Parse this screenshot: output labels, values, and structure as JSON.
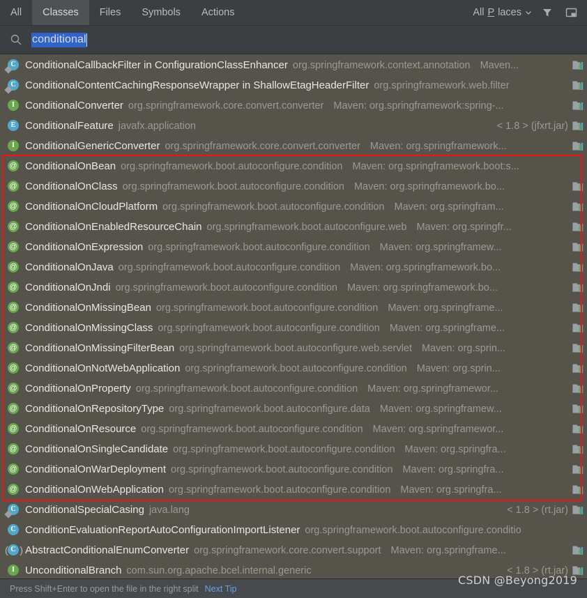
{
  "header": {
    "tabs": [
      {
        "label": "All",
        "active": false
      },
      {
        "label": "Classes",
        "active": true
      },
      {
        "label": "Files",
        "active": false
      },
      {
        "label": "Symbols",
        "active": false
      },
      {
        "label": "Actions",
        "active": false
      }
    ],
    "places_label_pre": "All ",
    "places_label_underlined": "P",
    "places_label_post": "laces",
    "filter_icon": "filter-funnel-icon",
    "preview_icon": "preview-panel-icon",
    "chevron_icon": "chevron-down-icon"
  },
  "search": {
    "icon": "search-icon",
    "value": "conditional",
    "selected": true
  },
  "results": [
    {
      "icon": "class-icon",
      "kind": "cls",
      "sub": true,
      "name": "ConditionalCallbackFilter in ConfigurationClassEnhancer",
      "pkg": "org.springframework.context.annotation",
      "loc": "Maven...",
      "loc_align": "left",
      "lib": true
    },
    {
      "icon": "class-icon",
      "kind": "cls",
      "sub": true,
      "name": "ConditionalContentCachingResponseWrapper in ShallowEtagHeaderFilter",
      "pkg": "org.springframework.web.filter",
      "loc": "",
      "loc_align": "left",
      "lib": true
    },
    {
      "icon": "interface-icon",
      "kind": "iface",
      "sub": false,
      "name": "ConditionalConverter",
      "pkg": "org.springframework.core.convert.converter",
      "loc": "Maven: org.springframework:spring-...",
      "loc_align": "left",
      "lib": true
    },
    {
      "icon": "enum-icon",
      "kind": "enum",
      "sub": false,
      "name": "ConditionalFeature",
      "pkg": "javafx.application",
      "loc": "< 1.8 > (jfxrt.jar)",
      "loc_align": "right",
      "lib": true
    },
    {
      "icon": "interface-icon",
      "kind": "iface",
      "sub": false,
      "name": "ConditionalGenericConverter",
      "pkg": "org.springframework.core.convert.converter",
      "loc": "Maven: org.springframework...",
      "loc_align": "left",
      "lib": true
    },
    {
      "icon": "annotation-icon",
      "kind": "anno",
      "sub": false,
      "name": "ConditionalOnBean",
      "pkg": "org.springframework.boot.autoconfigure.condition",
      "loc": "Maven: org.springframework.boot:s...",
      "loc_align": "left",
      "lib": false
    },
    {
      "icon": "annotation-icon",
      "kind": "anno",
      "sub": false,
      "name": "ConditionalOnClass",
      "pkg": "org.springframework.boot.autoconfigure.condition",
      "loc": "Maven: org.springframework.bo...",
      "loc_align": "left",
      "lib": true
    },
    {
      "icon": "annotation-icon",
      "kind": "anno",
      "sub": false,
      "name": "ConditionalOnCloudPlatform",
      "pkg": "org.springframework.boot.autoconfigure.condition",
      "loc": "Maven: org.springfram...",
      "loc_align": "left",
      "lib": true
    },
    {
      "icon": "annotation-icon",
      "kind": "anno",
      "sub": false,
      "name": "ConditionalOnEnabledResourceChain",
      "pkg": "org.springframework.boot.autoconfigure.web",
      "loc": "Maven: org.springfr...",
      "loc_align": "left",
      "lib": true
    },
    {
      "icon": "annotation-icon",
      "kind": "anno",
      "sub": false,
      "name": "ConditionalOnExpression",
      "pkg": "org.springframework.boot.autoconfigure.condition",
      "loc": "Maven: org.springframew...",
      "loc_align": "left",
      "lib": true
    },
    {
      "icon": "annotation-icon",
      "kind": "anno",
      "sub": false,
      "name": "ConditionalOnJava",
      "pkg": "org.springframework.boot.autoconfigure.condition",
      "loc": "Maven: org.springframework.bo...",
      "loc_align": "left",
      "lib": true
    },
    {
      "icon": "annotation-icon",
      "kind": "anno",
      "sub": false,
      "name": "ConditionalOnJndi",
      "pkg": "org.springframework.boot.autoconfigure.condition",
      "loc": "Maven: org.springframework.bo...",
      "loc_align": "left",
      "lib": true
    },
    {
      "icon": "annotation-icon",
      "kind": "anno",
      "sub": false,
      "name": "ConditionalOnMissingBean",
      "pkg": "org.springframework.boot.autoconfigure.condition",
      "loc": "Maven: org.springframe...",
      "loc_align": "left",
      "lib": true
    },
    {
      "icon": "annotation-icon",
      "kind": "anno",
      "sub": false,
      "name": "ConditionalOnMissingClass",
      "pkg": "org.springframework.boot.autoconfigure.condition",
      "loc": "Maven: org.springframe...",
      "loc_align": "left",
      "lib": true
    },
    {
      "icon": "annotation-icon",
      "kind": "anno",
      "sub": false,
      "name": "ConditionalOnMissingFilterBean",
      "pkg": "org.springframework.boot.autoconfigure.web.servlet",
      "loc": "Maven: org.sprin...",
      "loc_align": "left",
      "lib": true
    },
    {
      "icon": "annotation-icon",
      "kind": "anno",
      "sub": false,
      "name": "ConditionalOnNotWebApplication",
      "pkg": "org.springframework.boot.autoconfigure.condition",
      "loc": "Maven: org.sprin...",
      "loc_align": "left",
      "lib": true
    },
    {
      "icon": "annotation-icon",
      "kind": "anno",
      "sub": false,
      "name": "ConditionalOnProperty",
      "pkg": "org.springframework.boot.autoconfigure.condition",
      "loc": "Maven: org.springframewor...",
      "loc_align": "left",
      "lib": true
    },
    {
      "icon": "annotation-icon",
      "kind": "anno",
      "sub": false,
      "name": "ConditionalOnRepositoryType",
      "pkg": "org.springframework.boot.autoconfigure.data",
      "loc": "Maven: org.springframew...",
      "loc_align": "left",
      "lib": true
    },
    {
      "icon": "annotation-icon",
      "kind": "anno",
      "sub": false,
      "name": "ConditionalOnResource",
      "pkg": "org.springframework.boot.autoconfigure.condition",
      "loc": "Maven: org.springframewor...",
      "loc_align": "left",
      "lib": true
    },
    {
      "icon": "annotation-icon",
      "kind": "anno",
      "sub": false,
      "name": "ConditionalOnSingleCandidate",
      "pkg": "org.springframework.boot.autoconfigure.condition",
      "loc": "Maven: org.springfra...",
      "loc_align": "left",
      "lib": true
    },
    {
      "icon": "annotation-icon",
      "kind": "anno",
      "sub": false,
      "name": "ConditionalOnWarDeployment",
      "pkg": "org.springframework.boot.autoconfigure.condition",
      "loc": "Maven: org.springfra...",
      "loc_align": "left",
      "lib": true
    },
    {
      "icon": "annotation-icon",
      "kind": "anno",
      "sub": false,
      "name": "ConditionalOnWebApplication",
      "pkg": "org.springframework.boot.autoconfigure.condition",
      "loc": "Maven: org.springfra...",
      "loc_align": "left",
      "lib": true
    },
    {
      "icon": "class-icon",
      "kind": "cls",
      "sub": true,
      "name": "ConditionalSpecialCasing",
      "pkg": "java.lang",
      "loc": "< 1.8 > (rt.jar)",
      "loc_align": "right",
      "lib": true
    },
    {
      "icon": "class-icon",
      "kind": "cls",
      "sub": false,
      "name": "ConditionEvaluationReportAutoConfigurationImportListener",
      "pkg": "org.springframework.boot.autoconfigure.conditio",
      "loc": "",
      "loc_align": "left",
      "lib": false
    },
    {
      "icon": "abstract-class-icon",
      "kind": "cls",
      "sub": false,
      "abstract": true,
      "name": "AbstractConditionalEnumConverter",
      "pkg": "org.springframework.core.convert.support",
      "loc": "Maven: org.springframe...",
      "loc_align": "left",
      "lib": true
    },
    {
      "icon": "interface-icon",
      "kind": "iface",
      "sub": false,
      "name": "UnconditionalBranch",
      "pkg": "com.sun.org.apache.bcel.internal.generic",
      "loc": "< 1.8 > (rt.jar)",
      "loc_align": "right",
      "lib": true
    }
  ],
  "highlight_box": {
    "color": "#f01414",
    "first_row_index": 5,
    "last_row_index": 21
  },
  "status": {
    "tip": "Press Shift+Enter to open the file in the right split",
    "next_tip": "Next Tip"
  },
  "watermark": "CSDN @Beyong2019"
}
